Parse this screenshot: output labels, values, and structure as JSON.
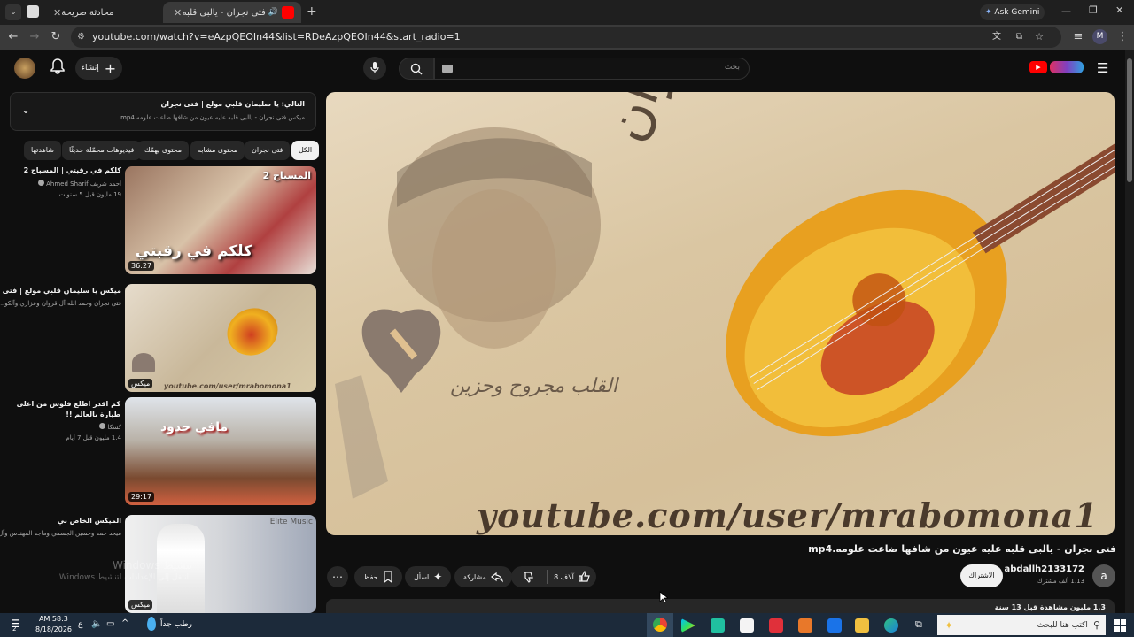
{
  "browser": {
    "tabs": [
      {
        "label": "محادثة صريحة"
      },
      {
        "label": "فتى نجران - يالبى قلبه عليه ..."
      }
    ],
    "ask_gemini": "Ask Gemini",
    "url": "youtube.com/watch?v=eAzpQEOIn44&list=RDeAzpQEOIn44&start_radio=1",
    "profile_letter": "M"
  },
  "header": {
    "create_label": "إنشاء",
    "search_placeholder": "بحث"
  },
  "playlist": {
    "next_label": "التالي: يا سليمان قلبي مولع | فتى نجران",
    "subtitle": "ميكس فتى نجران - يالبى قلبه عليه عيون من شافها ضاعت علومه.mp4"
  },
  "chips": [
    "الكل",
    "فتى نجران",
    "محتوى مشابه",
    "محتوى يهمّك",
    "فيديوهات محمّلة حديثًا",
    "شاهدتها"
  ],
  "videos": [
    {
      "title": "كلكم في رقبتي | المسباح 2",
      "channel": "أحمد شريف Ahmed Sharif",
      "meta": "19 مليون  قبل 5 سنوات",
      "duration": "36:27",
      "overlay": "كلكم في رقبتي",
      "badge": "المسباح 2"
    },
    {
      "title": "ميكس يا سليمان قلبي مولع | فتى نجران",
      "channel": "فتى نجران وحمد الله آل قروان وعزازي وآلكو...",
      "meta": "",
      "duration": "ميكس",
      "overlay": "",
      "badge": ""
    },
    {
      "title": "كم اقدر اطلع فلوس من اغلى طيارة بالعالم !!",
      "channel": "كسكا",
      "meta": "1.4 مليون  قبل 7 أيام",
      "duration": "29:17",
      "overlay": "مافي حدود",
      "badge": ""
    },
    {
      "title": "الميكس الخاص بي",
      "channel": "ميحد حمد وحسين الجسمي وماجد المهندس وآل...",
      "meta": "",
      "duration": "ميكس",
      "overlay": "Elite Music",
      "badge": ""
    }
  ],
  "player": {
    "watermark": "youtube.com/user/mrabomona1",
    "calligraphy": "فتى نجران",
    "heart_text": "القلب مجروح وحزين"
  },
  "video": {
    "title": "فتى نجران - يالبى قلبه عليه عيون من شافها ضاعت علومه.mp4",
    "channel": "abdallh2133172",
    "subscribers": "1.13 ألف مشترك",
    "subscribe_label": "الاشتراك",
    "avatar_letter": "a",
    "likes": "8 آلاف",
    "share_label": "مشاركة",
    "ask_label": "اسأل",
    "save_label": "حفظ",
    "stats": "1.3 مليون مشاهدة  قبل 13 سنة"
  },
  "windows": {
    "activate_line1": "Windows تنشيط",
    "activate_line2": ".Windows انتقل إلى الإعدادات لتنشيط",
    "search_placeholder": "اكتب هنا للبحث",
    "weather": "رطب جداً",
    "time": "AM 58:3",
    "date": "8/18/2026",
    "lang": "ع",
    "notif_count": "2"
  },
  "colors": {
    "accent_red": "#ff0000",
    "bg": "#0f0f0f"
  }
}
